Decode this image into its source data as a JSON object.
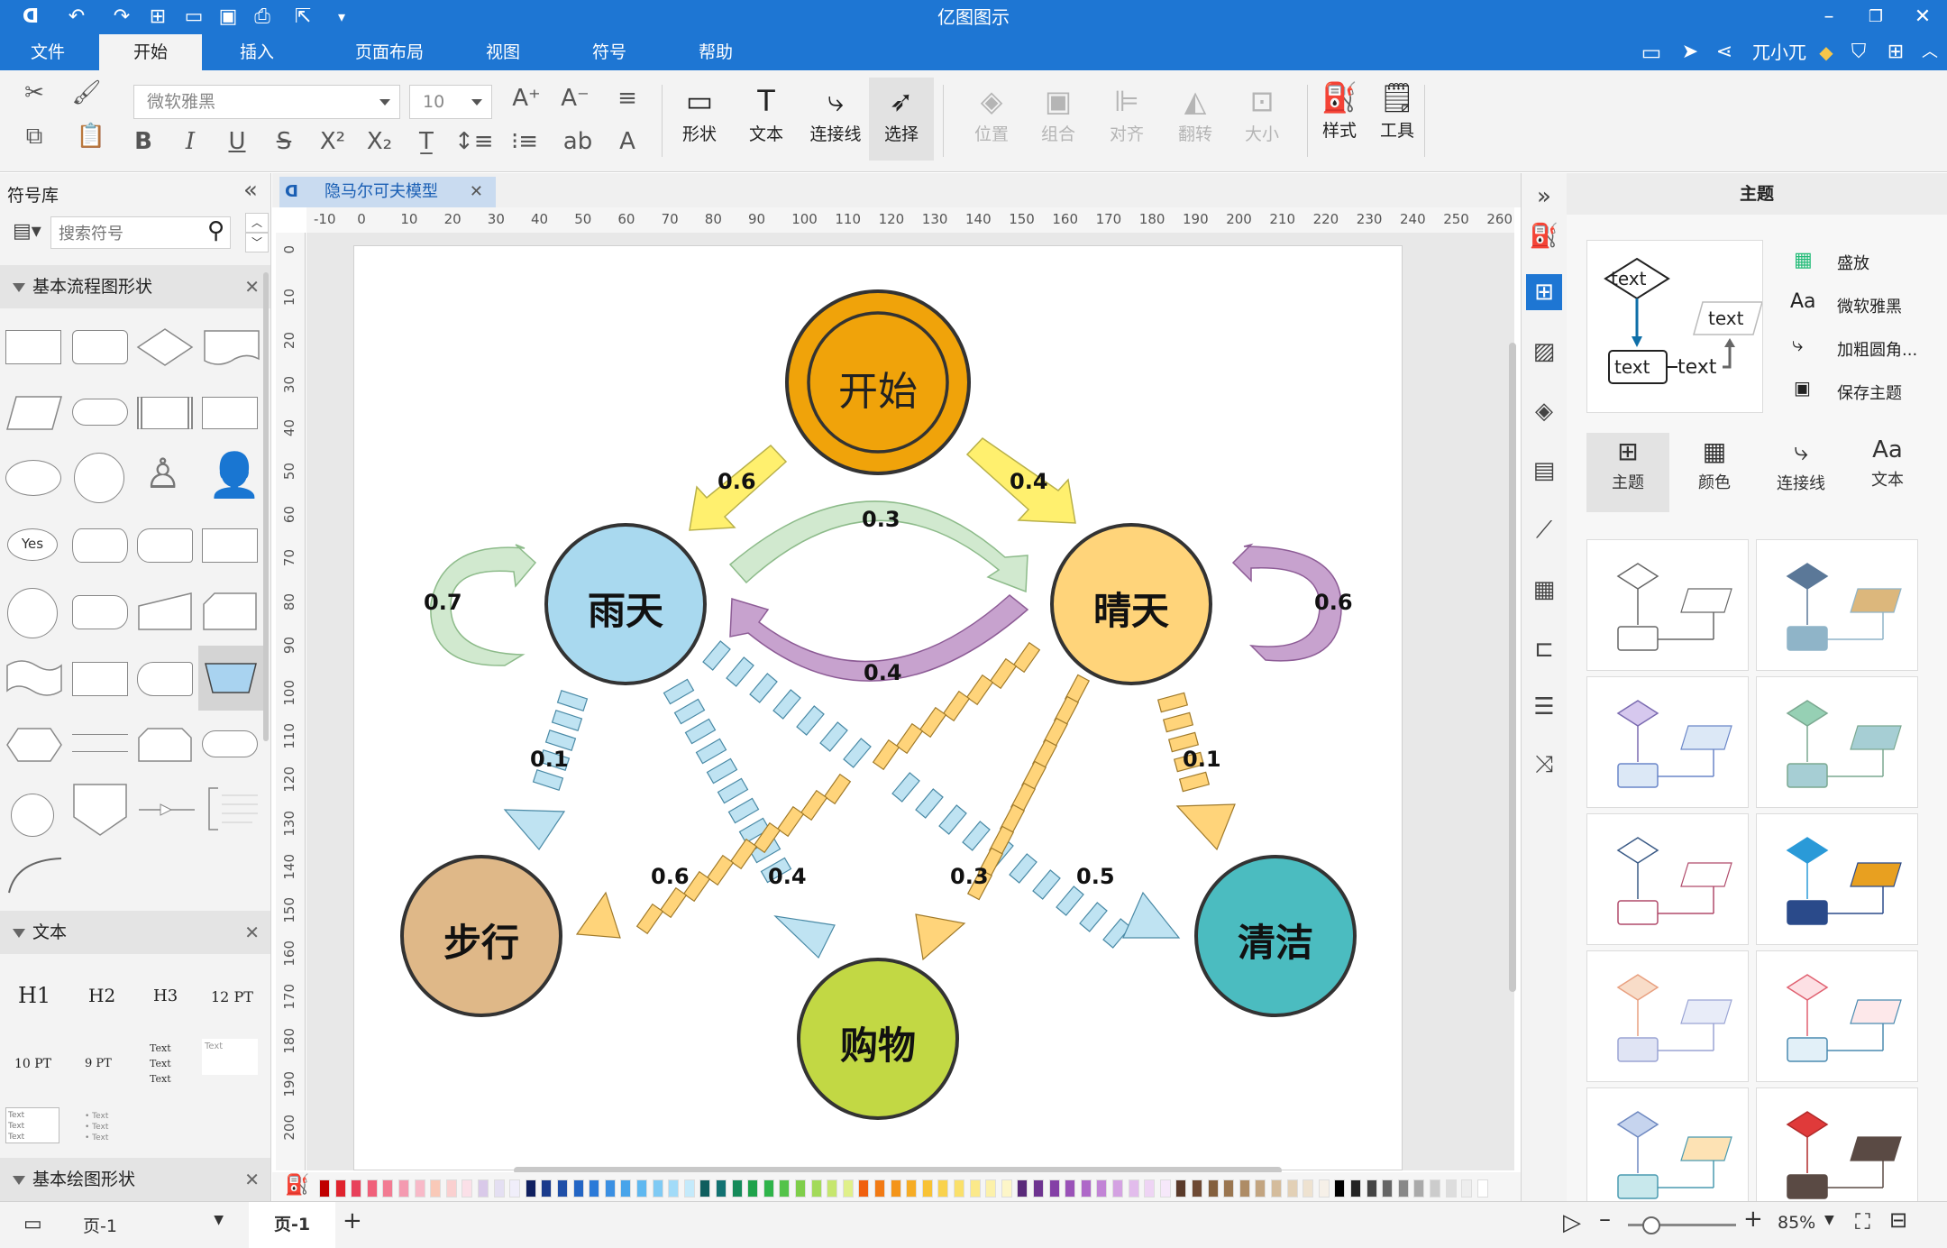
{
  "window": {
    "title": "亿图图示"
  },
  "menubar": {
    "items": [
      "文件",
      "开始",
      "插入",
      "页面布局",
      "视图",
      "符号",
      "帮助"
    ],
    "active_index": 1,
    "user_name": "兀小兀"
  },
  "ribbon": {
    "font_name": "微软雅黑",
    "font_size": "10",
    "tools": {
      "shape": "形状",
      "text": "文本",
      "connector": "连接线",
      "select": "选择",
      "position": "位置",
      "group": "组合",
      "align": "对齐",
      "flip": "翻转",
      "size": "大小",
      "style": "样式",
      "tool": "工具"
    }
  },
  "library": {
    "title": "符号库",
    "search_placeholder": "搜索符号",
    "sections": {
      "basic_flow": "基本流程图形状",
      "text": "文本",
      "basic_drawing": "基本绘图形状"
    },
    "shape_labels": {
      "yes": "Yes"
    },
    "text_samples": {
      "h1": "H1",
      "h2": "H2",
      "h3": "H3",
      "pt12": "12 PT",
      "pt10": "10 PT",
      "pt9": "9 PT",
      "text": "Text"
    }
  },
  "document": {
    "tab_title": "隐马尔可夫模型"
  },
  "ruler": {
    "h_ticks": [
      "-10",
      "0",
      "10",
      "20",
      "30",
      "40",
      "50",
      "60",
      "70",
      "80",
      "90",
      "100",
      "110",
      "120",
      "130",
      "140",
      "150",
      "160",
      "170",
      "180",
      "190",
      "200",
      "210",
      "220",
      "230",
      "240",
      "250",
      "260"
    ],
    "v_ticks": [
      "0",
      "10",
      "20",
      "30",
      "40",
      "50",
      "60",
      "70",
      "80",
      "90",
      "100",
      "110",
      "120",
      "130",
      "140",
      "150",
      "160",
      "170",
      "180",
      "190",
      "200"
    ]
  },
  "diagram": {
    "nodes": {
      "start": "开始",
      "rainy": "雨天",
      "sunny": "晴天",
      "walk": "步行",
      "shop": "购物",
      "clean": "清洁"
    },
    "edges": {
      "start_rainy": "0.6",
      "start_sunny": "0.4",
      "rainy_sunny": "0.3",
      "sunny_rainy": "0.4",
      "rainy_self": "0.7",
      "sunny_self": "0.6",
      "rainy_walk": "0.1",
      "rainy_shop": "0.4",
      "rainy_clean": "0.5",
      "sunny_walk": "0.6",
      "sunny_shop": "0.3",
      "sunny_clean": "0.1"
    },
    "colors": {
      "start": "#f0a30a",
      "rainy": "#a9d9ef",
      "sunny": "#ffd47a",
      "walk": "#dfb888",
      "shop": "#c2d844",
      "clean": "#4bbcc0"
    }
  },
  "status": {
    "page_select": "页-1",
    "page_tab": "页-1",
    "zoom": "85%"
  },
  "right_panel": {
    "title": "主题",
    "preview_text": "text",
    "options": [
      "盛放",
      "微软雅黑",
      "加粗圆角...",
      "保存主题"
    ],
    "tabs": [
      "主题",
      "颜色",
      "连接线",
      "文本"
    ]
  }
}
